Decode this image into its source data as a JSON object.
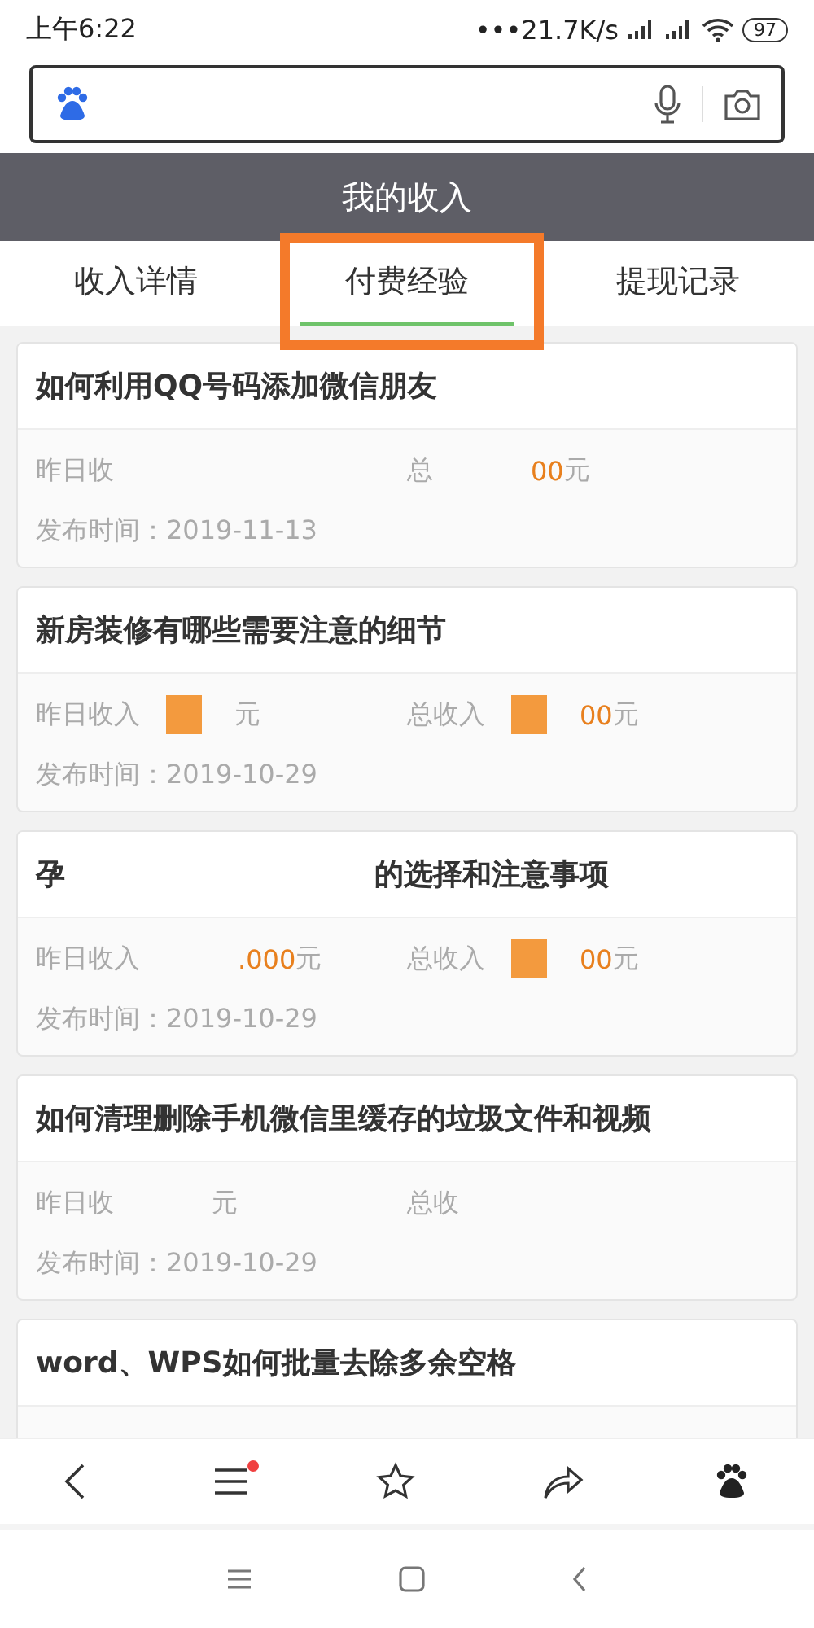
{
  "status_bar": {
    "time": "上午6:22",
    "speed": "•••21.7K/s",
    "battery": "97"
  },
  "header": {
    "title": "我的收入"
  },
  "tabs": [
    {
      "label": "收入详情",
      "selected": false
    },
    {
      "label": "付费经验",
      "selected": true
    },
    {
      "label": "提现记录",
      "selected": false
    }
  ],
  "cards": [
    {
      "title": [
        {
          "kind": "text",
          "text": "如何利用QQ号码添加微信朋友"
        }
      ],
      "yesterday": [
        {
          "kind": "label",
          "text": "昨日收"
        },
        {
          "kind": "gap"
        }
      ],
      "total": [
        {
          "kind": "label",
          "text": "总"
        },
        {
          "kind": "gap"
        },
        {
          "kind": "amount",
          "text": "00"
        },
        {
          "kind": "label",
          "text": "元"
        }
      ],
      "date": "发布时间：2019-11-13"
    },
    {
      "title": [
        {
          "kind": "text",
          "text": "新房装修有哪些需要注意的细节"
        }
      ],
      "yesterday": [
        {
          "kind": "label",
          "text": "昨日收入"
        },
        {
          "kind": "patch"
        },
        {
          "kind": "label",
          "text": "元"
        }
      ],
      "total": [
        {
          "kind": "label",
          "text": "总收入"
        },
        {
          "kind": "patch"
        },
        {
          "kind": "amount",
          "text": "00"
        },
        {
          "kind": "label",
          "text": "元"
        }
      ],
      "date": "发布时间：2019-10-29"
    },
    {
      "title": [
        {
          "kind": "text",
          "text": "孕"
        },
        {
          "kind": "gap"
        },
        {
          "kind": "text",
          "text": "的选择和注意事项"
        }
      ],
      "yesterday": [
        {
          "kind": "label",
          "text": "昨日收入"
        },
        {
          "kind": "gap"
        },
        {
          "kind": "amount",
          "text": ".000"
        },
        {
          "kind": "label",
          "text": "元"
        }
      ],
      "total": [
        {
          "kind": "label",
          "text": "总收入"
        },
        {
          "kind": "patch"
        },
        {
          "kind": "amount",
          "text": "00"
        },
        {
          "kind": "label",
          "text": "元"
        }
      ],
      "date": "发布时间：2019-10-29"
    },
    {
      "title": [
        {
          "kind": "text",
          "text": "如何清理删除手机微信里缓存的垃圾文件和视频"
        }
      ],
      "yesterday": [
        {
          "kind": "label",
          "text": "昨日收"
        },
        {
          "kind": "gap"
        },
        {
          "kind": "label",
          "text": "元"
        }
      ],
      "total": [
        {
          "kind": "label",
          "text": "总收"
        },
        {
          "kind": "gap"
        }
      ],
      "date": "发布时间：2019-10-29"
    },
    {
      "title": [
        {
          "kind": "text",
          "text": "word、WPS如何批量去除多余空格"
        }
      ]
    }
  ],
  "highlight": {
    "kind": "box"
  },
  "bottom_nav": {
    "menu_badge": true
  }
}
